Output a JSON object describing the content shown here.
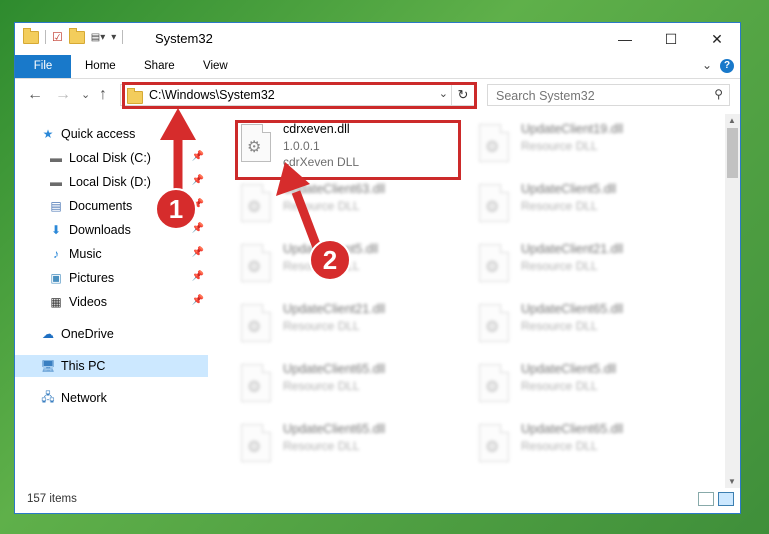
{
  "window": {
    "title": "System32",
    "controls": {
      "minimize": "—",
      "maximize": "☐",
      "close": "✕"
    }
  },
  "ribbon": {
    "tabs": [
      "File",
      "Home",
      "Share",
      "View"
    ],
    "help": "?",
    "expand": "⌄"
  },
  "navigation": {
    "back": "←",
    "forward": "→",
    "recent": "⌄",
    "up": "↑",
    "address": "C:\\Windows\\System32",
    "address_dropdown": "⌄",
    "refresh": "↻",
    "search_placeholder": "Search System32",
    "search_icon": "⚲"
  },
  "sidebar": {
    "items": [
      {
        "label": "Quick access",
        "icon": "star-icon",
        "glyph": "★",
        "color": "#2b88d8",
        "pinned": false
      },
      {
        "label": "Local Disk (C:)",
        "icon": "drive-icon",
        "glyph": "▬",
        "color": "#6b6b6b",
        "pinned": true
      },
      {
        "label": "Local Disk (D:)",
        "icon": "drive-icon",
        "glyph": "▬",
        "color": "#6b6b6b",
        "pinned": true
      },
      {
        "label": "Documents",
        "icon": "document-icon",
        "glyph": "▤",
        "color": "#4a76b4",
        "pinned": true
      },
      {
        "label": "Downloads",
        "icon": "download-icon",
        "glyph": "⬇",
        "color": "#2b88d8",
        "pinned": true
      },
      {
        "label": "Music",
        "icon": "music-icon",
        "glyph": "♪",
        "color": "#2b88d8",
        "pinned": true
      },
      {
        "label": "Pictures",
        "icon": "pictures-icon",
        "glyph": "▣",
        "color": "#4a90c0",
        "pinned": true
      },
      {
        "label": "Videos",
        "icon": "video-icon",
        "glyph": "▦",
        "color": "#333333",
        "pinned": true
      },
      {
        "label": "OneDrive",
        "icon": "cloud-icon",
        "glyph": "☁",
        "color": "#1e6fc2",
        "pinned": false
      },
      {
        "label": "This PC",
        "icon": "computer-icon",
        "glyph": "🖥",
        "color": "#3a7fc1",
        "pinned": false
      },
      {
        "label": "Network",
        "icon": "network-icon",
        "glyph": "🖧",
        "color": "#3a7fc1",
        "pinned": false
      }
    ],
    "pin_glyph": "📌"
  },
  "files": [
    {
      "name": "cdrxeven.dll",
      "line1": "1.0.0.1",
      "line2": "cdrXeven DLL",
      "blurred": false
    },
    {
      "name": "UpdateClient19.dll",
      "line1": "Resource DLL",
      "line2": "",
      "blurred": true
    },
    {
      "name": "UpdateClient63.dll",
      "line1": "Resource DLL",
      "line2": "",
      "blurred": true
    },
    {
      "name": "UpdateClient5.dll",
      "line1": "Resource DLL",
      "line2": "",
      "blurred": true
    },
    {
      "name": "UpdateClient5.dll",
      "line1": "Resource DLL",
      "line2": "",
      "blurred": true
    },
    {
      "name": "UpdateClient21.dll",
      "line1": "Resource DLL",
      "line2": "",
      "blurred": true
    },
    {
      "name": "UpdateClient21.dll",
      "line1": "Resource DLL",
      "line2": "",
      "blurred": true
    },
    {
      "name": "UpdateClient65.dll",
      "line1": "Resource DLL",
      "line2": "",
      "blurred": true
    },
    {
      "name": "UpdateClient65.dll",
      "line1": "Resource DLL",
      "line2": "",
      "blurred": true
    },
    {
      "name": "UpdateClient5.dll",
      "line1": "Resource DLL",
      "line2": "",
      "blurred": true
    },
    {
      "name": "UpdateClient65.dll",
      "line1": "Resource DLL",
      "line2": "",
      "blurred": true
    },
    {
      "name": "UpdateClient65.dll",
      "line1": "Resource DLL",
      "line2": "",
      "blurred": true
    }
  ],
  "status": {
    "items_count": "157 items"
  },
  "annotations": {
    "step1": "1",
    "step2": "2",
    "color": "#d62c2c"
  }
}
